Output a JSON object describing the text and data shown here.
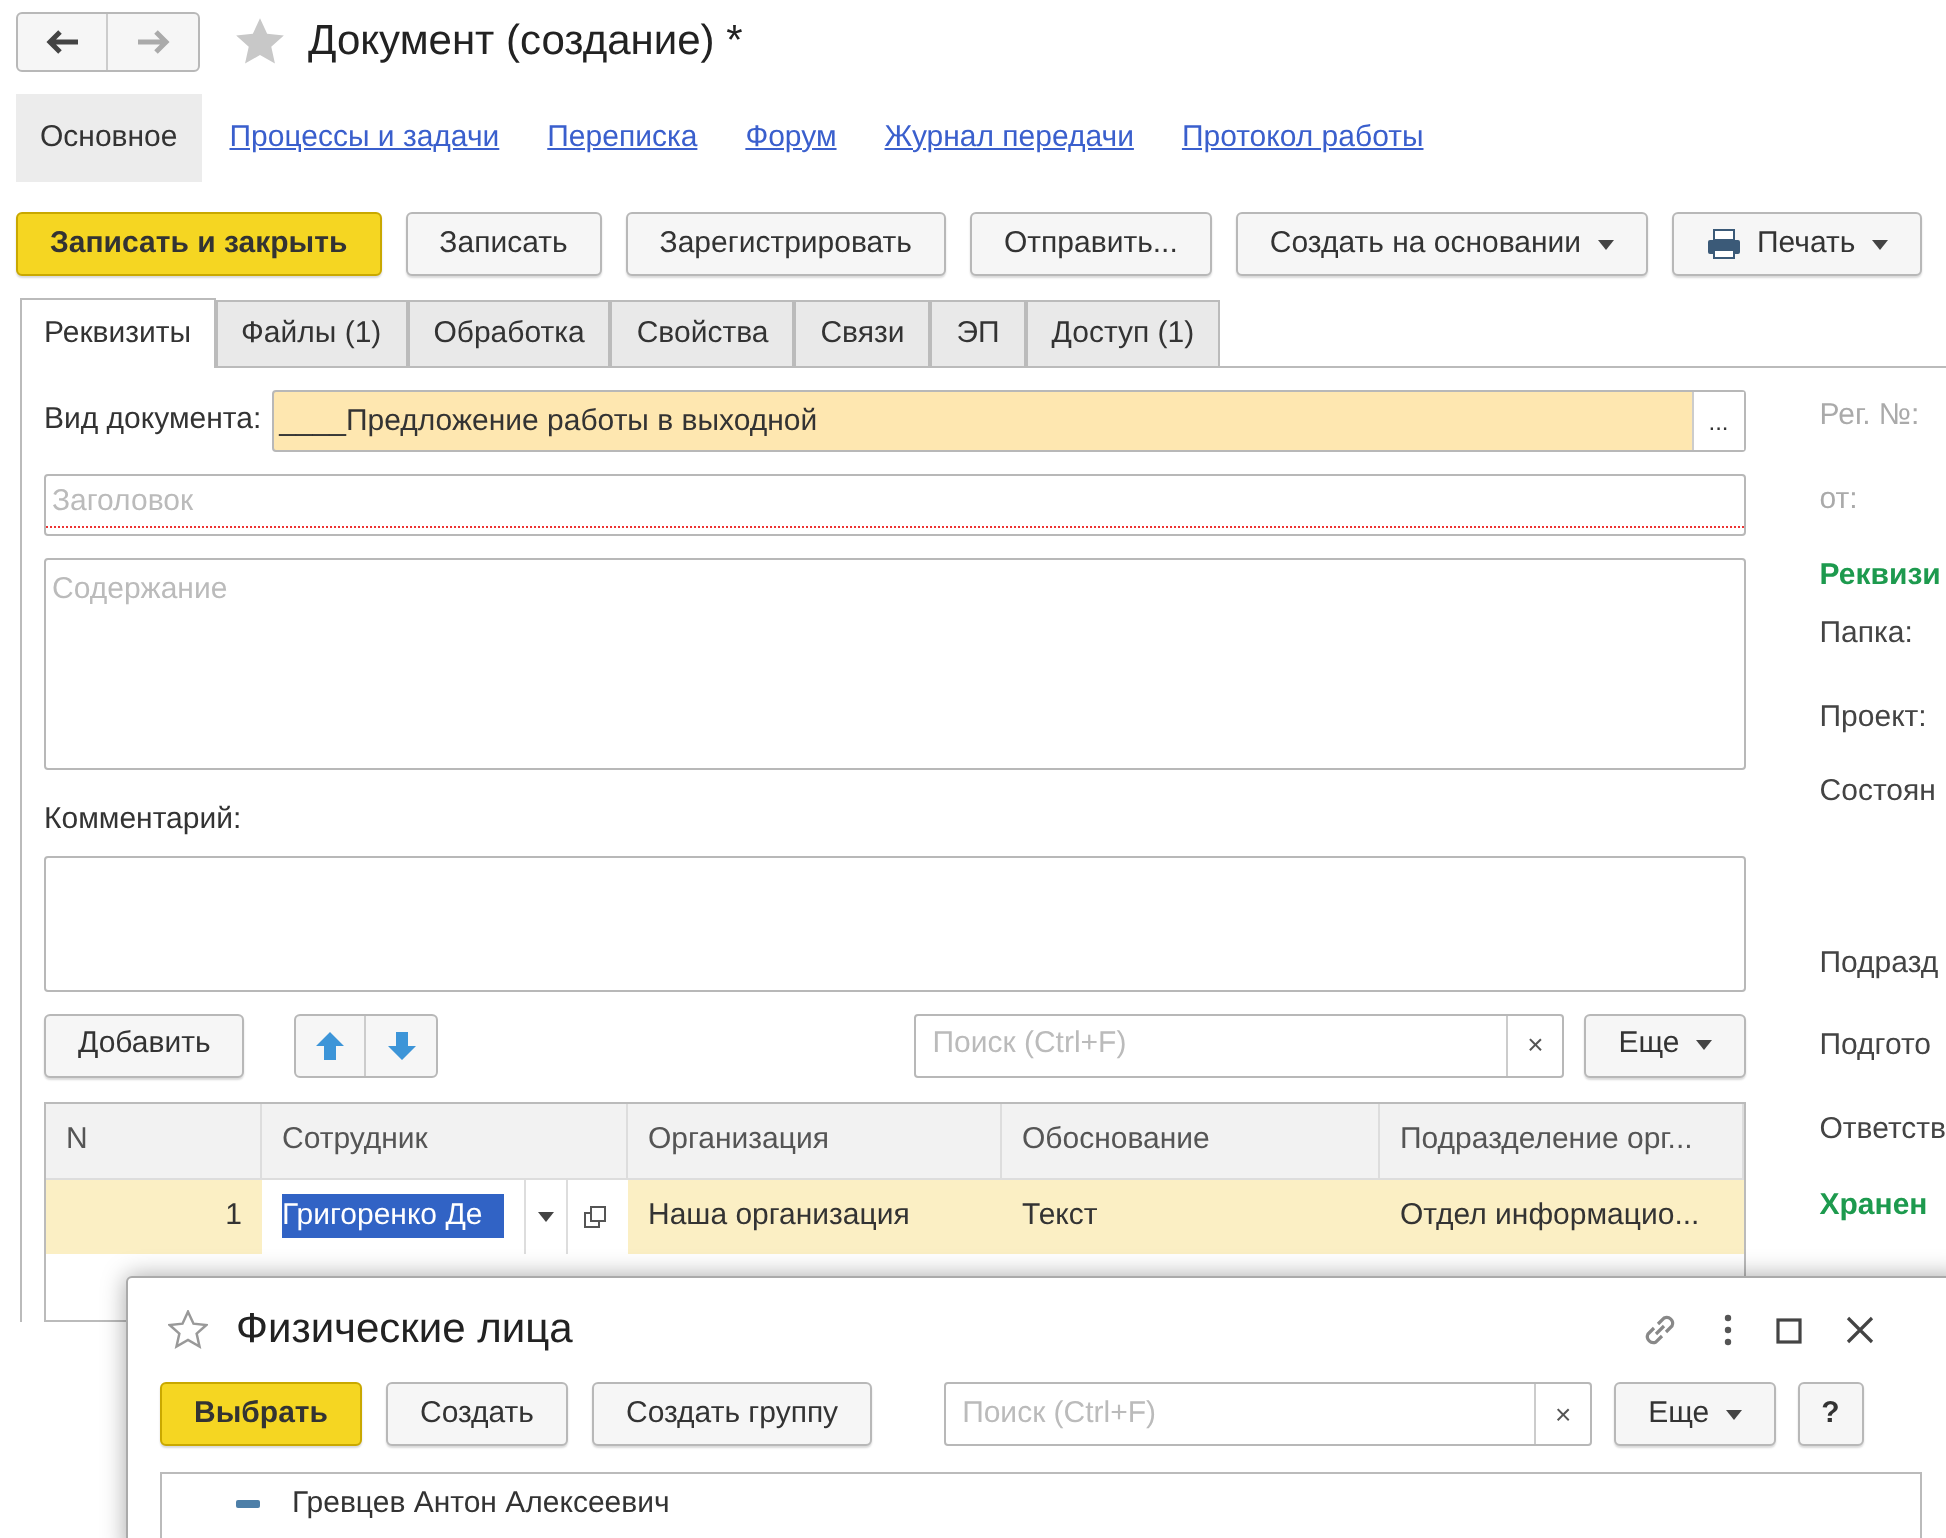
{
  "header": {
    "title": "Документ (создание) *"
  },
  "nav": [
    {
      "label": "Основное",
      "selected": true
    },
    {
      "label": "Процессы и задачи",
      "selected": false
    },
    {
      "label": "Переписка",
      "selected": false
    },
    {
      "label": "Форум",
      "selected": false
    },
    {
      "label": "Журнал передачи",
      "selected": false
    },
    {
      "label": "Протокол работы",
      "selected": false
    }
  ],
  "toolbar": [
    {
      "label": "Записать и закрыть",
      "kind": "primary"
    },
    {
      "label": "Записать",
      "kind": "plain"
    },
    {
      "label": "Зарегистрировать",
      "kind": "plain"
    },
    {
      "label": "Отправить...",
      "kind": "plain"
    },
    {
      "label": "Создать на основании",
      "kind": "dropdown"
    },
    {
      "label": "Печать",
      "kind": "print"
    }
  ],
  "tabs": [
    {
      "label": "Реквизиты",
      "selected": true
    },
    {
      "label": "Файлы (1)",
      "selected": false
    },
    {
      "label": "Обработка",
      "selected": false
    },
    {
      "label": "Свойства",
      "selected": false
    },
    {
      "label": "Связи",
      "selected": false
    },
    {
      "label": "ЭП",
      "selected": false
    },
    {
      "label": "Доступ (1)",
      "selected": false
    }
  ],
  "form": {
    "choose": "...",
    "doc_type_label": "Вид документа:",
    "doc_type_value": "____Предложение работы в выходной",
    "title_placeholder": "Заголовок",
    "content_placeholder": "Содержание",
    "comment_label": "Комментарий:"
  },
  "table_toolbar": {
    "add": "Добавить",
    "search_placeholder": "Поиск (Ctrl+F)",
    "clear": "×",
    "more": "Еще"
  },
  "table": {
    "columns": [
      "N",
      "Сотрудник",
      "Организация",
      "Обоснование",
      "Подразделение орг..."
    ],
    "rows": [
      {
        "n": "1",
        "employee": "Григоренко Де",
        "organization": "Наша организация",
        "basis": "Текст",
        "department": "Отдел информацио...",
        "selected": true
      }
    ]
  },
  "right_panel": [
    {
      "kind": "muted",
      "text": "Рег. №:"
    },
    {
      "kind": "muted",
      "text": "от:"
    },
    {
      "kind": "section",
      "text": "Реквизи"
    },
    {
      "kind": "label",
      "text": "Папка:"
    },
    {
      "kind": "label",
      "text": "Проект:"
    },
    {
      "kind": "label",
      "text": "Состоян"
    },
    {
      "kind": "label",
      "text": "Подразд"
    },
    {
      "kind": "label",
      "text": "Подгото"
    },
    {
      "kind": "label",
      "text": "Ответств"
    },
    {
      "kind": "section",
      "text": "Хранен"
    }
  ],
  "popup": {
    "title": "Физические лица",
    "buttons": [
      {
        "label": "Выбрать",
        "kind": "primary"
      },
      {
        "label": "Создать",
        "kind": "plain"
      },
      {
        "label": "Создать группу",
        "kind": "plain"
      }
    ],
    "search_placeholder": "Поиск (Ctrl+F)",
    "clear": "×",
    "more": "Еще",
    "help": "?",
    "rows": [
      {
        "name": "Гревцев Антон Алексеевич"
      }
    ]
  }
}
